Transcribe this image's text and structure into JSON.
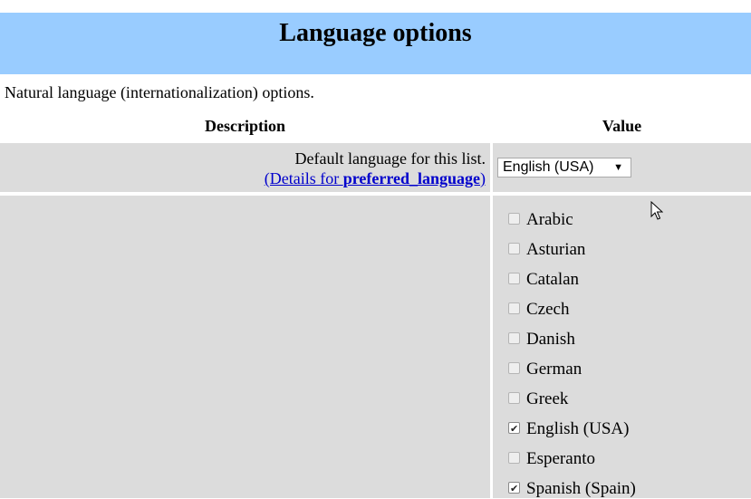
{
  "header": {
    "title": "Language options"
  },
  "intro": "Natural language (internationalization) options.",
  "table": {
    "col_description": "Description",
    "col_value": "Value"
  },
  "rows": {
    "default_language": {
      "description": "Default language for this list.",
      "link_prefix": "(Details for ",
      "link_bold": "preferred_language",
      "link_suffix": ")",
      "selected_value": "English (USA)"
    }
  },
  "languages": [
    {
      "label": "Arabic",
      "checked": false
    },
    {
      "label": "Asturian",
      "checked": false
    },
    {
      "label": "Catalan",
      "checked": false
    },
    {
      "label": "Czech",
      "checked": false
    },
    {
      "label": "Danish",
      "checked": false
    },
    {
      "label": "German",
      "checked": false
    },
    {
      "label": "Greek",
      "checked": false
    },
    {
      "label": "English (USA)",
      "checked": true
    },
    {
      "label": "Esperanto",
      "checked": false
    },
    {
      "label": "Spanish (Spain)",
      "checked": true
    }
  ]
}
